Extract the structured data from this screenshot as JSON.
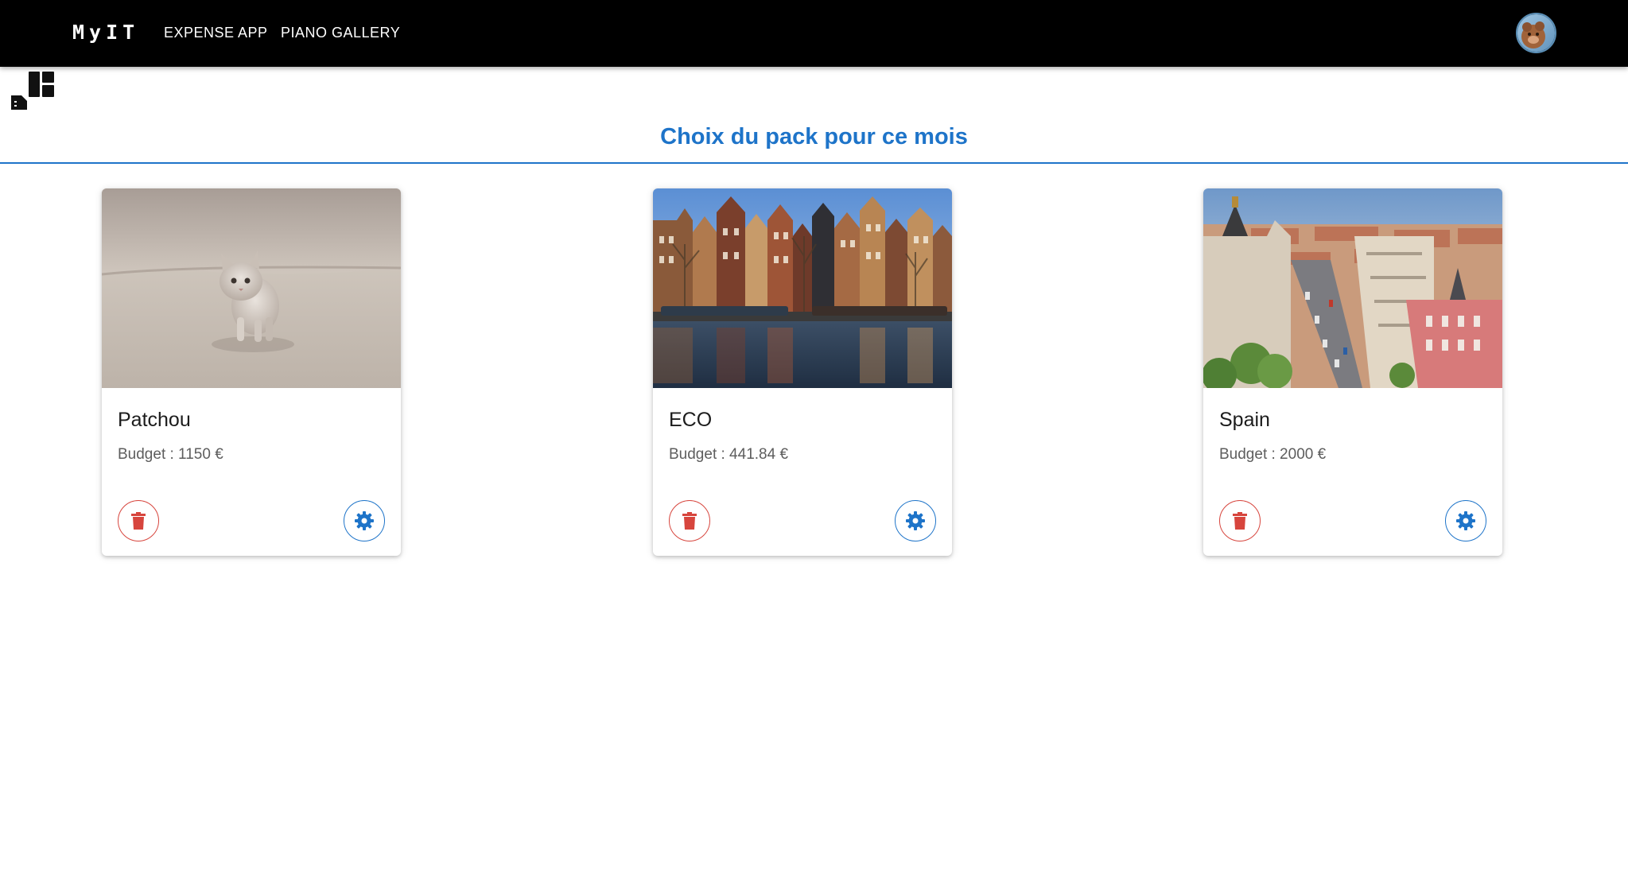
{
  "appbar": {
    "logo": "MyIT",
    "nav": [
      {
        "label": "EXPENSE APP"
      },
      {
        "label": "PIANO GALLERY"
      }
    ]
  },
  "page": {
    "title": "Choix du pack pour ce mois"
  },
  "cards": [
    {
      "title": "Patchou",
      "budget": "Budget : 1150 €",
      "image": "kitten-photo"
    },
    {
      "title": "ECO",
      "budget": "Budget : 441.84 €",
      "image": "amsterdam-canal-photo"
    },
    {
      "title": "Spain",
      "budget": "Budget : 2000 €",
      "image": "madrid-city-photo"
    }
  ],
  "colors": {
    "accent": "#1e74c9",
    "danger": "#d7453d",
    "appbar": "#000000"
  }
}
